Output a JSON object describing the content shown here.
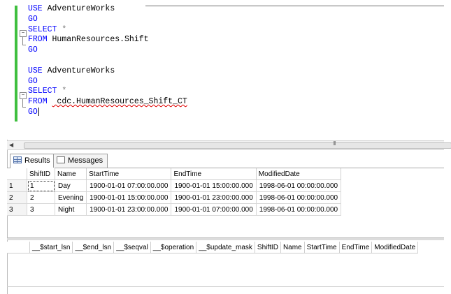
{
  "editor": {
    "lines": [
      {
        "kw": "USE",
        "rest": " AdventureWorks"
      },
      {
        "kw": "GO",
        "rest": ""
      },
      {
        "kw": "SELECT",
        "rest": " *"
      },
      {
        "kw": "FROM",
        "rest": " HumanResources.Shift"
      },
      {
        "kw": "GO",
        "rest": ""
      },
      {
        "kw": "",
        "rest": ""
      },
      {
        "kw": "USE",
        "rest": " AdventureWorks"
      },
      {
        "kw": "GO",
        "rest": ""
      },
      {
        "kw": "SELECT",
        "rest": " *"
      },
      {
        "kw": "FROM",
        "rest": " cdc.HumanResources_Shift_CT"
      },
      {
        "kw": "GO",
        "rest": ""
      }
    ]
  },
  "scrollbar": {
    "grip": "III"
  },
  "tabs": {
    "results": "Results",
    "messages": "Messages"
  },
  "grid1": {
    "columns": [
      "",
      "ShiftID",
      "Name",
      "StartTime",
      "EndTime",
      "ModifiedDate"
    ],
    "rows": [
      [
        "1",
        "1",
        "Day",
        "1900-01-01 07:00:00.000",
        "1900-01-01 15:00:00.000",
        "1998-06-01 00:00:00.000"
      ],
      [
        "2",
        "2",
        "Evening",
        "1900-01-01 15:00:00.000",
        "1900-01-01 23:00:00.000",
        "1998-06-01 00:00:00.000"
      ],
      [
        "3",
        "3",
        "Night",
        "1900-01-01 23:00:00.000",
        "1900-01-01 07:00:00.000",
        "1998-06-01 00:00:00.000"
      ]
    ]
  },
  "grid2": {
    "columns": [
      "",
      "__$start_lsn",
      "__$end_lsn",
      "__$seqval",
      "__$operation",
      "__$update_mask",
      "ShiftID",
      "Name",
      "StartTime",
      "EndTime",
      "ModifiedDate"
    ]
  }
}
